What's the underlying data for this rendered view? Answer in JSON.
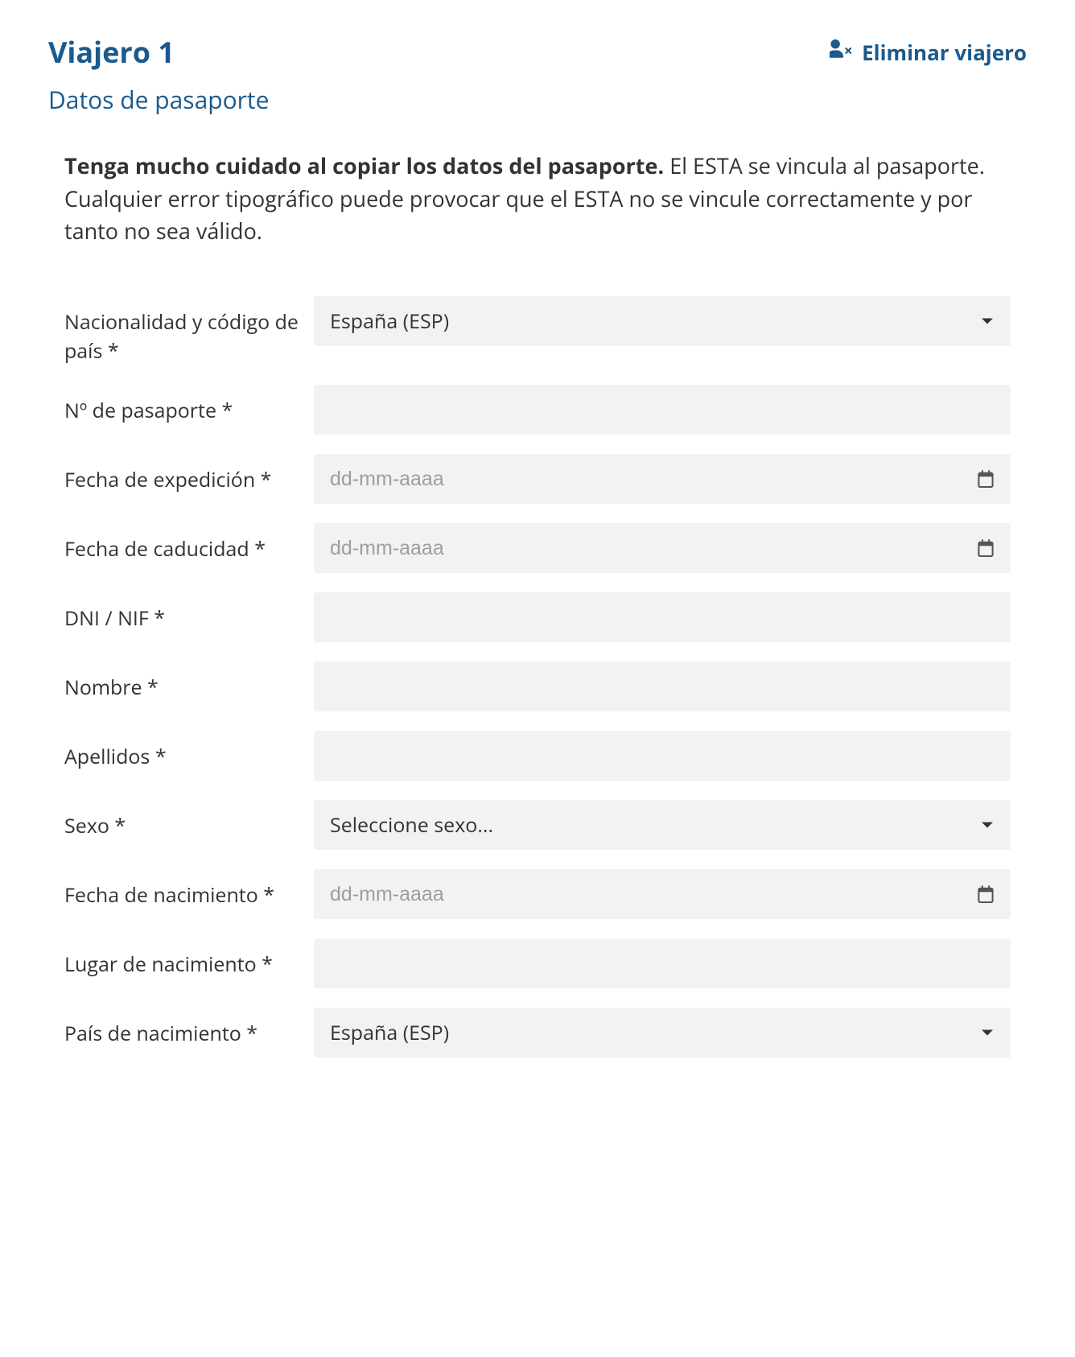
{
  "header": {
    "title": "Viajero 1",
    "remove_label": "Eliminar viajero"
  },
  "subtitle": "Datos de pasaporte",
  "warning": {
    "bold": "Tenga mucho cuidado al copiar los datos del pasaporte.",
    "rest": " El ESTA se vincula al pasaporte. Cualquier error tipográfico puede provocar que el ESTA no se vincule correctamente y por tanto no sea válido."
  },
  "fields": {
    "nationality": {
      "label": "Nacionalidad y código de país *",
      "value": "España (ESP)"
    },
    "passport_no": {
      "label": "Nº de pasaporte *",
      "value": ""
    },
    "issue_date": {
      "label": "Fecha de expedición *",
      "placeholder": "dd-mm-aaaa",
      "value": ""
    },
    "expiry_date": {
      "label": "Fecha de caducidad *",
      "placeholder": "dd-mm-aaaa",
      "value": ""
    },
    "dni": {
      "label": "DNI / NIF *",
      "value": ""
    },
    "first_name": {
      "label": "Nombre *",
      "value": ""
    },
    "last_name": {
      "label": "Apellidos *",
      "value": ""
    },
    "sex": {
      "label": "Sexo *",
      "value": "Seleccione sexo..."
    },
    "birth_date": {
      "label": "Fecha de nacimiento *",
      "placeholder": "dd-mm-aaaa",
      "value": ""
    },
    "birth_place": {
      "label": "Lugar de nacimiento *",
      "value": ""
    },
    "birth_country": {
      "label": "País de nacimiento *",
      "value": "España (ESP)"
    }
  }
}
